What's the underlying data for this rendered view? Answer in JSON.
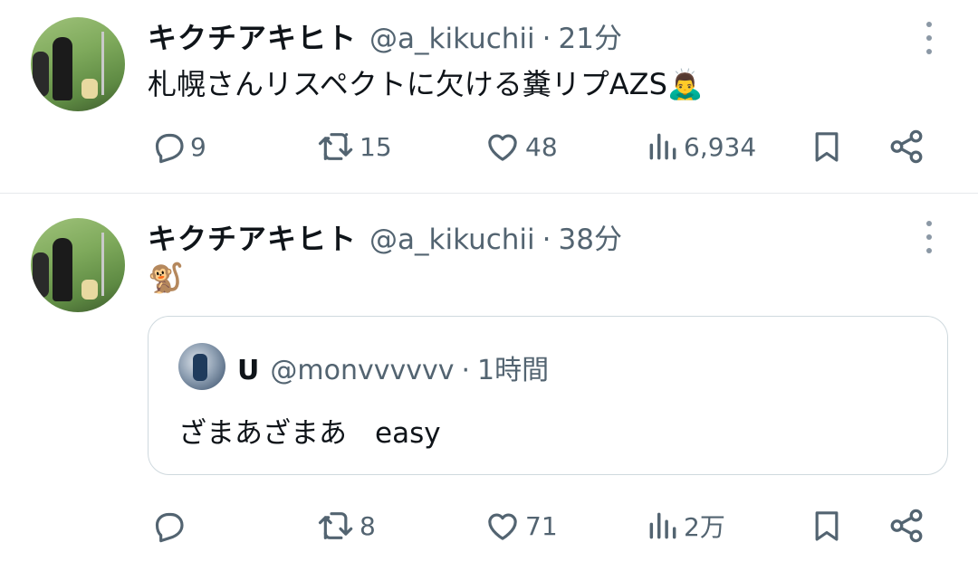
{
  "tweets": [
    {
      "author_name": "キクチアキヒト",
      "handle": "@a_kikuchii",
      "separator": "·",
      "time": "21分",
      "text": "札幌さんリスペクトに欠ける糞リプAZS🙇‍♂️",
      "reply_count": "9",
      "retweet_count": "15",
      "like_count": "48",
      "view_count": "6,934"
    },
    {
      "author_name": "キクチアキヒト",
      "handle": "@a_kikuchii",
      "separator": "·",
      "time": "38分",
      "text": "🐒",
      "quote": {
        "author_name": "U",
        "handle": "@monvvvvvv",
        "separator": "·",
        "time": "1時間",
        "text": "ざまあざまあ　easy"
      },
      "reply_count": "",
      "retweet_count": "8",
      "like_count": "71",
      "view_count": "2万"
    }
  ],
  "icons": {
    "more": "more-vertical-icon",
    "reply": "reply-icon",
    "retweet": "retweet-icon",
    "like": "heart-icon",
    "views": "views-icon",
    "bookmark": "bookmark-icon",
    "share": "share-icon"
  },
  "colors": {
    "text_primary": "#0f1419",
    "text_secondary": "#536471",
    "border": "#cfd9de"
  }
}
